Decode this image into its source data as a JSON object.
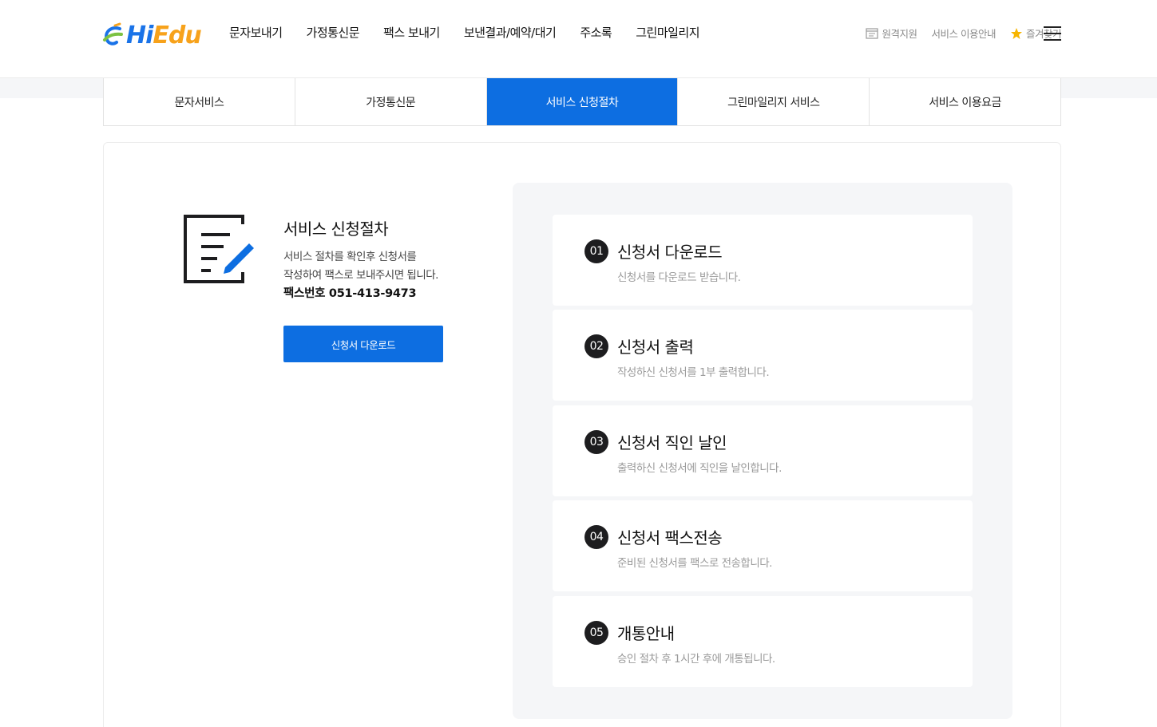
{
  "header": {
    "logo_text_a": "Hi",
    "logo_text_b": "Edu",
    "nav": [
      "문자보내기",
      "가정통신문",
      "팩스 보내기",
      "보낸결과/예약/대기",
      "주소록",
      "그린마일리지"
    ],
    "util": {
      "remote_support": "원격지원",
      "service_guide": "서비스 이용안내",
      "bookmark": "즐겨찾기"
    }
  },
  "tabs": [
    "문자서비스",
    "가정통신문",
    "서비스 신청절차",
    "그린마일리지 서비스",
    "서비스 이용요금"
  ],
  "active_tab": "서비스 신청절차",
  "intro": {
    "title": "서비스 신청절차",
    "desc_line1": "서비스 절차를 확인후 신청서를",
    "desc_line2": "작성하여 팩스로 보내주시면 됩니다.",
    "fax": "팩스번호 051-413-9473",
    "download_button": "신청서 다운로드"
  },
  "steps": [
    {
      "num": "01",
      "title": "신청서 다운로드",
      "desc": "신청서를 다운로드 받습니다."
    },
    {
      "num": "02",
      "title": "신청서 출력",
      "desc": "작성하신 신청서를 1부 출력합니다."
    },
    {
      "num": "03",
      "title": "신청서 직인 날인",
      "desc": "출력하신 신청서에 직인을 날인합니다."
    },
    {
      "num": "04",
      "title": "신청서 팩스전송",
      "desc": "준비된 신청서를 팩스로 전송합니다."
    },
    {
      "num": "05",
      "title": "개통안내",
      "desc": "승인 절차 후 1시간 후에 개통됩니다."
    }
  ],
  "colors": {
    "primary": "#0d6ee1",
    "logo_orange": "#f7a21b",
    "step_badge": "#1d1d1f",
    "steps_bg": "#f5f6f8"
  },
  "icons": [
    "document-edit-icon",
    "remote-support-icon",
    "star-icon",
    "hamburger-menu-icon",
    "logo-mark-icon"
  ]
}
